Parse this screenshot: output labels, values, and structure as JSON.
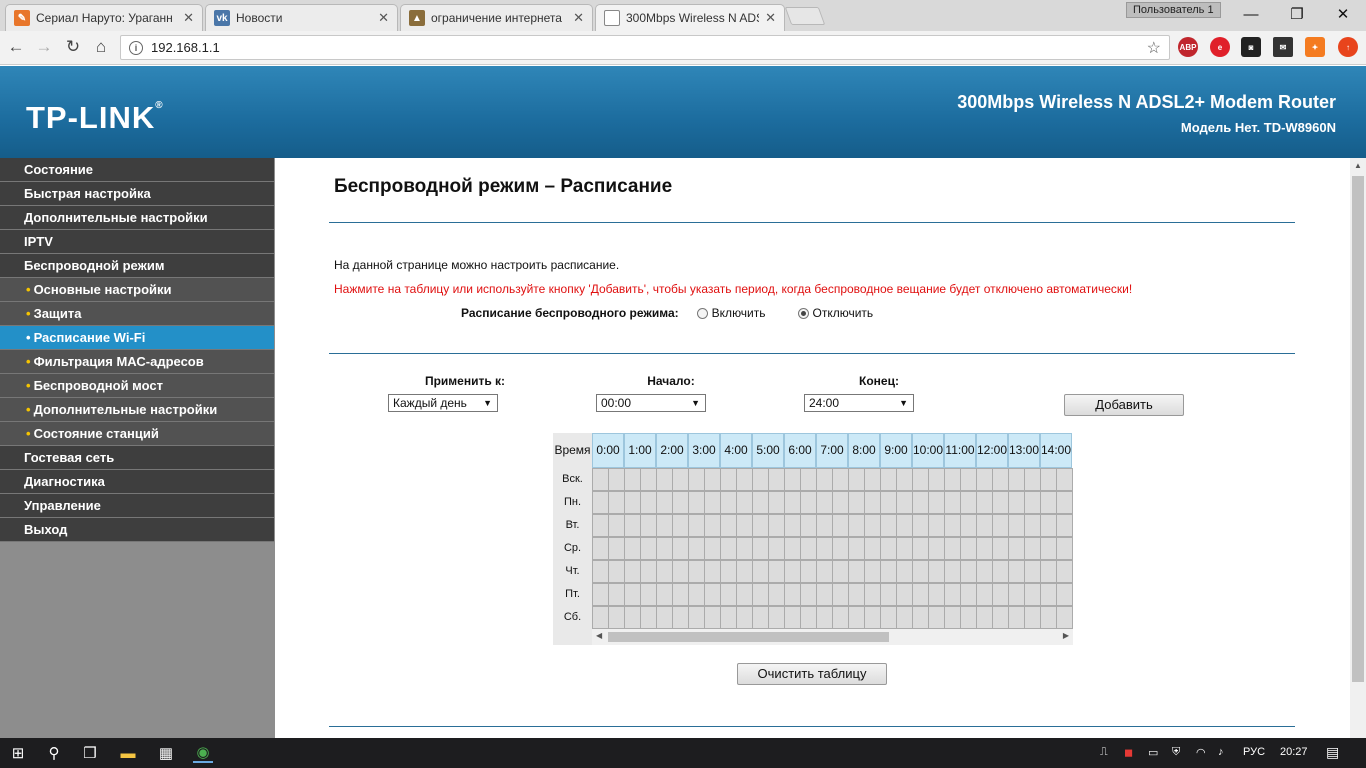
{
  "browser": {
    "tabs": [
      {
        "title": "Сериал Наруто: Ураганн",
        "favicon": "naruto-favicon",
        "active": false
      },
      {
        "title": "Новости",
        "favicon": "vk-favicon",
        "active": false
      },
      {
        "title": "ограничение интернета",
        "favicon": "hat-favicon",
        "active": false
      },
      {
        "title": "300Mbps Wireless N ADS",
        "favicon": "page-favicon",
        "active": true
      }
    ],
    "user_label": "Пользователь 1",
    "url": "192.168.1.1"
  },
  "header": {
    "logo": "TP-LINK",
    "model_title": "300Mbps Wireless N ADSL2+ Modem Router",
    "model_sub": "Модель Нет. TD-W8960N"
  },
  "sidebar": {
    "items": [
      {
        "label": "Состояние",
        "type": "main"
      },
      {
        "label": "Быстрая настройка",
        "type": "main"
      },
      {
        "label": "Дополнительные настройки",
        "type": "main"
      },
      {
        "label": "IPTV",
        "type": "main"
      },
      {
        "label": "Беспроводной режим",
        "type": "main"
      },
      {
        "label": "Основные настройки",
        "type": "sub"
      },
      {
        "label": "Защита",
        "type": "sub"
      },
      {
        "label": "Расписание Wi-Fi",
        "type": "sub",
        "active": true
      },
      {
        "label": "Фильтрация МАС-адресов",
        "type": "sub"
      },
      {
        "label": "Беспроводной мост",
        "type": "sub"
      },
      {
        "label": "Дополнительные настройки",
        "type": "sub"
      },
      {
        "label": "Состояние станций",
        "type": "sub"
      },
      {
        "label": "Гостевая сеть",
        "type": "main"
      },
      {
        "label": "Диагностика",
        "type": "main"
      },
      {
        "label": "Управление",
        "type": "main"
      },
      {
        "label": "Выход",
        "type": "main"
      }
    ]
  },
  "page": {
    "title": "Беспроводной режим – Расписание",
    "description": "На данной странице можно настроить расписание.",
    "warning": "Нажмите на таблицу или используйте кнопку 'Добавить', чтобы указать период, когда беспроводное вещание будет отключено автоматически!",
    "schedule_label": "Расписание беспроводного режима:",
    "radio_on": "Включить",
    "radio_off": "Отключить",
    "schedule_enabled": false,
    "apply_label": "Применить к:",
    "apply_value": "Каждый день",
    "start_label": "Начало:",
    "start_value": "00:00",
    "end_label": "Конец:",
    "end_value": "24:00",
    "add_button": "Добавить",
    "clear_button": "Очистить таблицу",
    "table": {
      "time_header": "Время",
      "hours": [
        "0:00",
        "1:00",
        "2:00",
        "3:00",
        "4:00",
        "5:00",
        "6:00",
        "7:00",
        "8:00",
        "9:00",
        "10:00",
        "11:00",
        "12:00",
        "13:00",
        "14:00"
      ],
      "days": [
        "Вск.",
        "Пн.",
        "Вт.",
        "Ср.",
        "Чт.",
        "Пт.",
        "Сб."
      ]
    }
  },
  "taskbar": {
    "language": "РУС",
    "time": "20:27"
  },
  "colors": {
    "header_blue": "#1c6c9e",
    "menu_dark": "#3e3e3e",
    "menu_active": "#2390c8",
    "warning_red": "#e01010",
    "hour_header": "#cce9f7"
  }
}
